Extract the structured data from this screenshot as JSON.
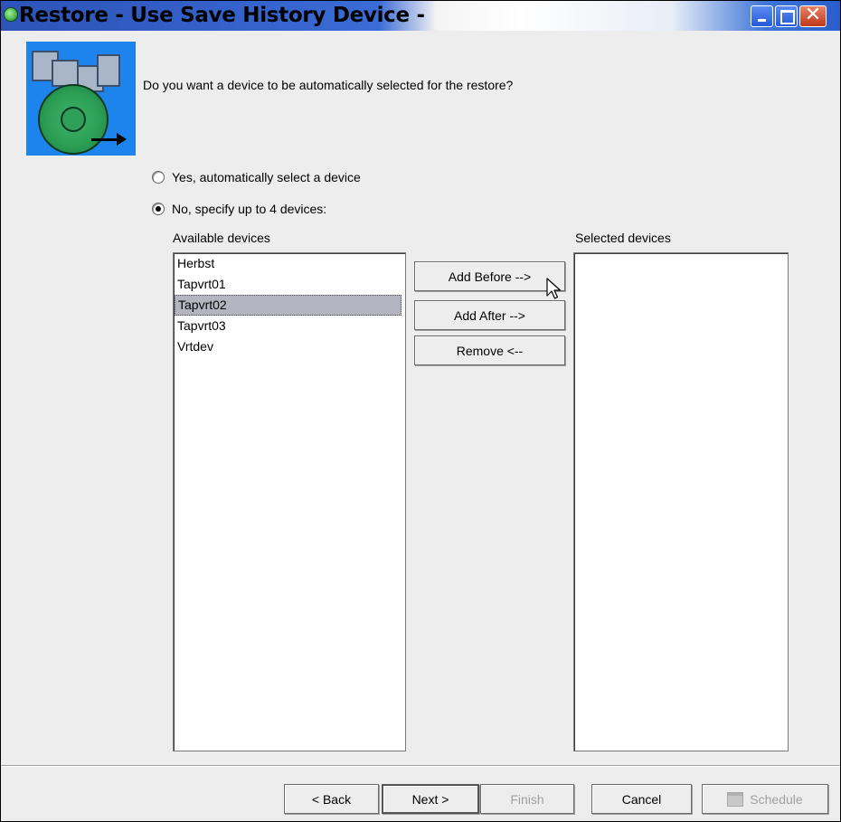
{
  "window": {
    "title": "Restore - Use Save History Device -"
  },
  "wizard": {
    "question": "Do you want a device to be automatically selected for the restore?",
    "options": [
      {
        "label": "Yes, automatically select a device",
        "selected": false
      },
      {
        "label": "No, specify up to 4 devices:",
        "selected": true
      }
    ]
  },
  "available": {
    "label": "Available devices",
    "items": [
      "Herbst",
      "Tapvrt01",
      "Tapvrt02",
      "Tapvrt03",
      "Vrtdev"
    ],
    "selected_index": 2
  },
  "selected": {
    "label": "Selected devices",
    "items": []
  },
  "actions": {
    "add_before": "Add Before -->",
    "add_after": "Add After -->",
    "remove": "Remove <--"
  },
  "footer": {
    "back": "< Back",
    "next": "Next >",
    "finish": "Finish",
    "cancel": "Cancel",
    "schedule": "Schedule"
  },
  "icons": {
    "title": "app-icon",
    "wizard": "tape-restore-icon",
    "minimize": "minimize-icon",
    "maximize": "maximize-icon",
    "close": "close-icon",
    "schedule": "calendar-icon",
    "cursor": "mouse-pointer-icon"
  },
  "colors": {
    "titlebar_blue": "#2d53b8",
    "window_bg": "#ededed",
    "wizard_icon_bg": "#1d84ed",
    "selection_bg": "#b5b5c2",
    "disabled_text": "#a0a0a0"
  }
}
